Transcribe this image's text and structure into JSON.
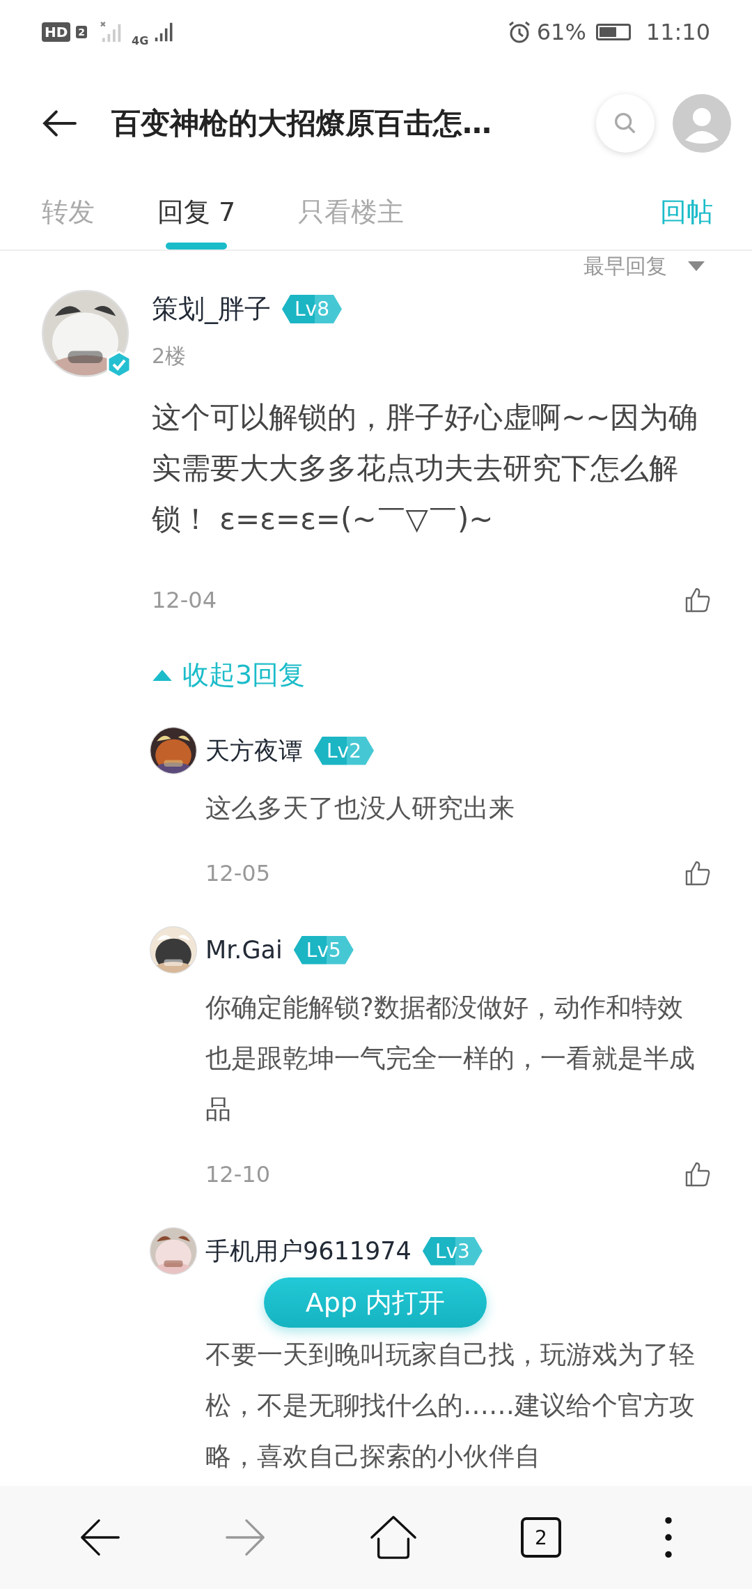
{
  "status_bar": {
    "hd": "HD",
    "sim": "2",
    "network": "4G",
    "battery": "61%",
    "time": "11:10"
  },
  "header": {
    "title": "百变神枪的大招燎原百击怎…"
  },
  "tabs": [
    {
      "label": "转发",
      "selected": false
    },
    {
      "label": "回复 7",
      "selected": true
    },
    {
      "label": "只看楼主",
      "selected": false
    }
  ],
  "reply_button": "回帖",
  "sort": "最早回复",
  "post": {
    "author": "策划_胖子",
    "level": "Lv8",
    "verified": true,
    "floor": "2楼",
    "body": "这个可以解锁的，胖子好心虚啊~~因为确实需要大大多多花点功夫去研究下怎么解锁！ ε=ε=ε=(~￣▽￣)~",
    "date": "12-04"
  },
  "collapse": "收起3回复",
  "replies": [
    {
      "author": "天方夜谭",
      "level": "Lv2",
      "body": "这么多天了也没人研究出来",
      "date": "12-05"
    },
    {
      "author": "Mr.Gai",
      "level": "Lv5",
      "body": "你确定能解锁?数据都没做好，动作和特效也是跟乾坤一气完全一样的，一看就是半成品",
      "date": "12-10"
    },
    {
      "author": "手机用户9611974",
      "level": "Lv3",
      "body": "不要一天到晚叫玩家自己找，玩游戏为了轻松，不是无聊找什么的……建议给个官方攻略，喜欢自己探索的小伙伴自"
    }
  ],
  "open_app_button": "App 内打开",
  "bottom_nav": {
    "tab_count": "2",
    "forward_disabled": true
  }
}
